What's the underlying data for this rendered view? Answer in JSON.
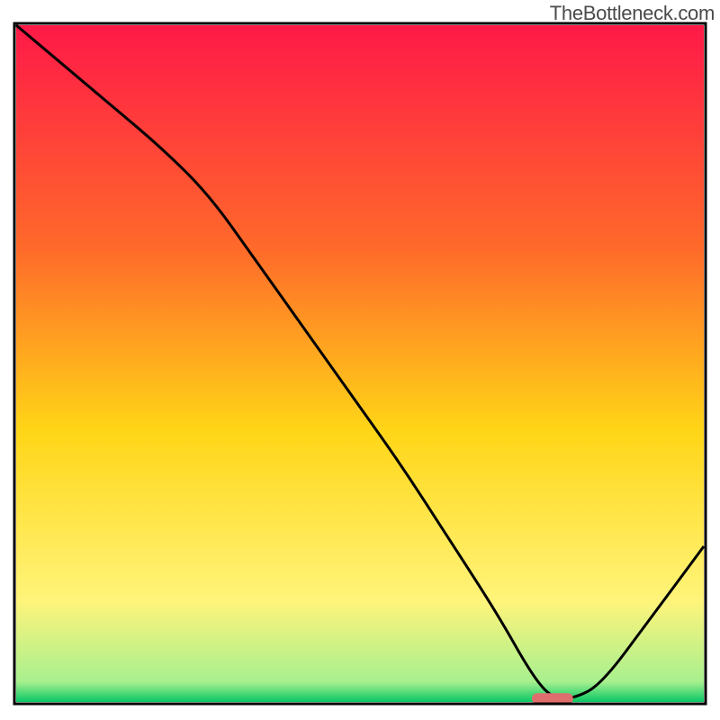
{
  "watermark": "TheBottleneck.com",
  "chart_data": {
    "type": "line",
    "title": "",
    "xlabel": "",
    "ylabel": "",
    "xlim": [
      0,
      100
    ],
    "ylim": [
      0,
      100
    ],
    "x": [
      0,
      7,
      14,
      21,
      28,
      35,
      42,
      49,
      56,
      63,
      70,
      75,
      78,
      81,
      85,
      92,
      100
    ],
    "values": [
      100,
      94,
      88,
      82,
      75,
      65,
      55,
      45,
      35,
      24,
      13,
      4,
      0.5,
      0.5,
      2.5,
      12,
      23
    ],
    "optimum_x_range": [
      75,
      81
    ],
    "optimum_y": 0.5,
    "gradient": {
      "from": "#ff1948",
      "via1": "#ff6a2a",
      "via2": "#ffd617",
      "via3": "#fff47a",
      "to": "#08c765"
    },
    "marker_color": "#e06d6d",
    "curve_color": "#000000",
    "border_color": "#000000"
  }
}
